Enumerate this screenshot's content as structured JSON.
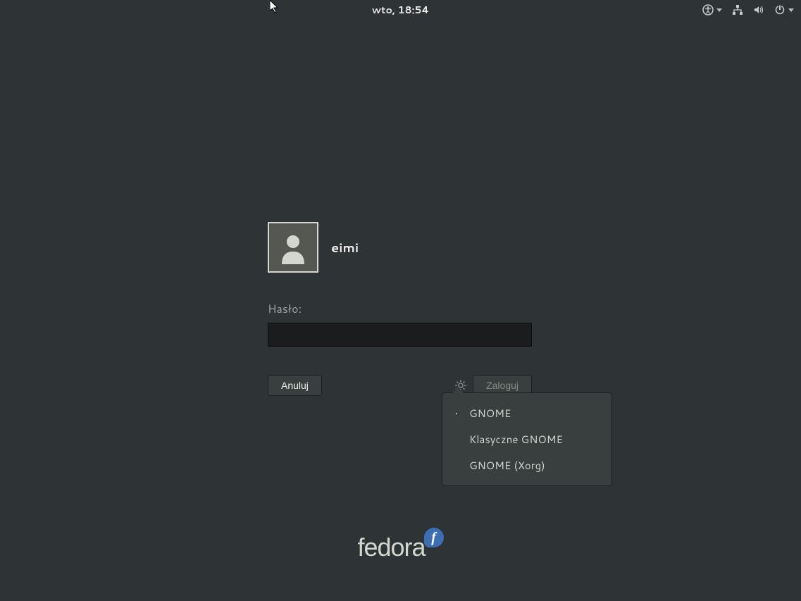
{
  "topbar": {
    "clock": "wto, 18:54"
  },
  "login": {
    "username": "eimi",
    "password_label": "Hasło:",
    "cancel_label": "Anuluj",
    "signin_label": "Zaloguj"
  },
  "session_menu": {
    "items": [
      {
        "label": "GNOME",
        "selected": true
      },
      {
        "label": "Klasyczne GNOME",
        "selected": false
      },
      {
        "label": "GNOME (Xorg)",
        "selected": false
      }
    ]
  },
  "branding": {
    "distro": "fedora"
  }
}
